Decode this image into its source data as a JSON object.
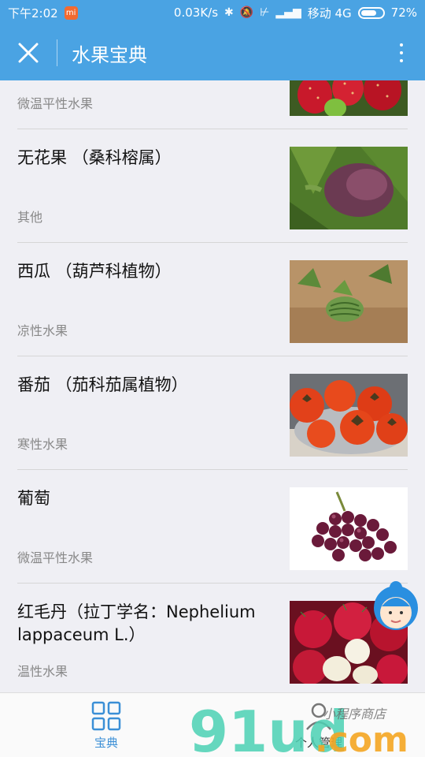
{
  "status": {
    "time": "下午2:02",
    "speed": "0.03K/s",
    "carrier": "移动 4G",
    "battery": "72%",
    "battery_level": 0.72
  },
  "nav": {
    "title": "水果宝典"
  },
  "items": [
    {
      "title": "",
      "category": "微温平性水果",
      "image": "strawberry"
    },
    {
      "title": "无花果 （桑科榕属）",
      "category": "其他",
      "image": "fig"
    },
    {
      "title": "西瓜 （葫芦科植物）",
      "category": "凉性水果",
      "image": "watermelon"
    },
    {
      "title": "番茄 （茄科茄属植物）",
      "category": "寒性水果",
      "image": "persimmon"
    },
    {
      "title": "葡萄",
      "category": "微温平性水果",
      "image": "grape"
    },
    {
      "title": "红毛丹（拉丁学名：Nephelium lappaceum L.）",
      "category": "温性水果",
      "image": "rambutan"
    }
  ],
  "tabs": [
    {
      "label": "宝典",
      "icon": "grid-icon",
      "active": true
    },
    {
      "label": "个人管理",
      "icon": "person-icon",
      "active": false
    }
  ],
  "watermark": {
    "logo": "91ud.com",
    "slogan": "小程序商店"
  },
  "colors": {
    "primary": "#4aa3e3",
    "tab_active": "#3b8fd6",
    "category_text": "#888888"
  }
}
